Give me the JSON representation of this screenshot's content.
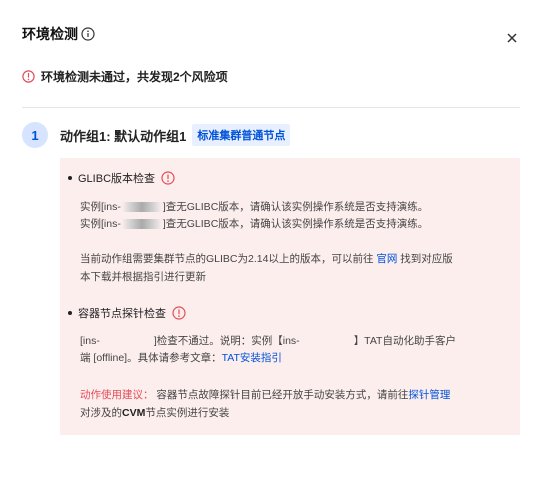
{
  "dialog": {
    "title": "环境检测",
    "alert_text": "环境检测未通过，共发现2个风险项"
  },
  "step": {
    "number": "1",
    "group_title": "动作组1: 默认动作组1",
    "group_tag": "标准集群普通节点"
  },
  "checks": [
    {
      "title": "GLIBC版本检查",
      "lines": [
        {
          "prefix": "实例[ins-",
          "suffix": "]查无GLIBC版本，请确认该实例操作系统是否支持演练。"
        },
        {
          "prefix": "实例[ins-",
          "suffix": "]查无GLIBC版本，请确认该实例操作系统是否支持演练。"
        }
      ],
      "note_line1_pre": "当前动作组需要集群节点的GLIBC为2.14以上的版本，可以前往",
      "note_link": "官网",
      "note_line1_post": "找到对应版",
      "note_line2": "本下载并根据指引进行更新"
    },
    {
      "title": "容器节点探针检查",
      "line1_a": "[ins-",
      "line1_b": "]检查不通过。说明：实例【ins-",
      "line1_c": "】TAT自动化助手客户",
      "line2_a": "端 [offline]。具体请参考文章：",
      "line2_link": "TAT安装指引",
      "suggest_label": "动作使用建议：",
      "suggest_text": "容器节点故障探针目前已经开放手动安装方式，请前往",
      "suggest_link": "探针管理",
      "suggest2_a": "对涉及的",
      "suggest2_bold": "CVM",
      "suggest2_b": "节点实例进行安装"
    }
  ]
}
